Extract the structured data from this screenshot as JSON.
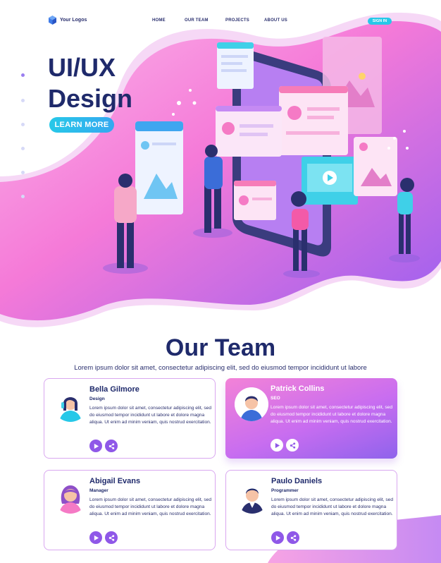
{
  "brand": {
    "logo_text": "Your Logos"
  },
  "nav": {
    "items": [
      {
        "label": "HOME"
      },
      {
        "label": "OUR TEAM"
      },
      {
        "label": "PROJECTS"
      },
      {
        "label": "ABOUT US"
      }
    ],
    "signin_label": "SIGN IN"
  },
  "hero": {
    "title_line1": "UI/UX",
    "title_line2": "Design",
    "cta_label": "LEARN MORE"
  },
  "team": {
    "title": "Our Team",
    "subtitle": "Lorem ipsum dolor sit amet, consectetur adipiscing elit, sed do eiusmod tempor incididunt ut labore",
    "members": [
      {
        "name": "Bella Gilmore",
        "role": "Design",
        "bio": "Lorem ipsum dolor sit amet, consectetur adipiscing elit, sed do eiusmod tempor incididunt ut labore et dolore magna aliqua. Ut enim ad minim veniam, quis nostrud exercitation.",
        "active": false
      },
      {
        "name": "Patrick Collins",
        "role": "SEO",
        "bio": "Lorem ipsum dolor sit amet, consectetur adipiscing elit, sed do eiusmod tempor incididunt ut labore et dolore magna aliqua. Ut enim ad minim veniam, quis nostrud exercitation.",
        "active": true
      },
      {
        "name": "Abigail Evans",
        "role": "Manager",
        "bio": "Lorem ipsum dolor sit amet, consectetur adipiscing elit, sed do eiusmod tempor incididunt ut labore et dolore magna aliqua. Ut enim ad minim veniam, quis nostrud exercitation.",
        "active": false
      },
      {
        "name": "Paulo Daniels",
        "role": "Programmer",
        "bio": "Lorem ipsum dolor sit amet, consectetur adipiscing elit, sed do eiusmod tempor incididunt ut labore et dolore magna aliqua. Ut enim ad minim veniam, quis nostrud exercitation.",
        "active": false
      }
    ]
  },
  "icons": {
    "logo": "cube-logo-icon",
    "card_play": "play-icon",
    "card_share": "share-icon"
  },
  "colors": {
    "brand_navy": "#1f2a6b",
    "accent_cyan": "#27c8e8",
    "accent_purple": "#8f58e8",
    "accent_pink": "#f382d7"
  }
}
